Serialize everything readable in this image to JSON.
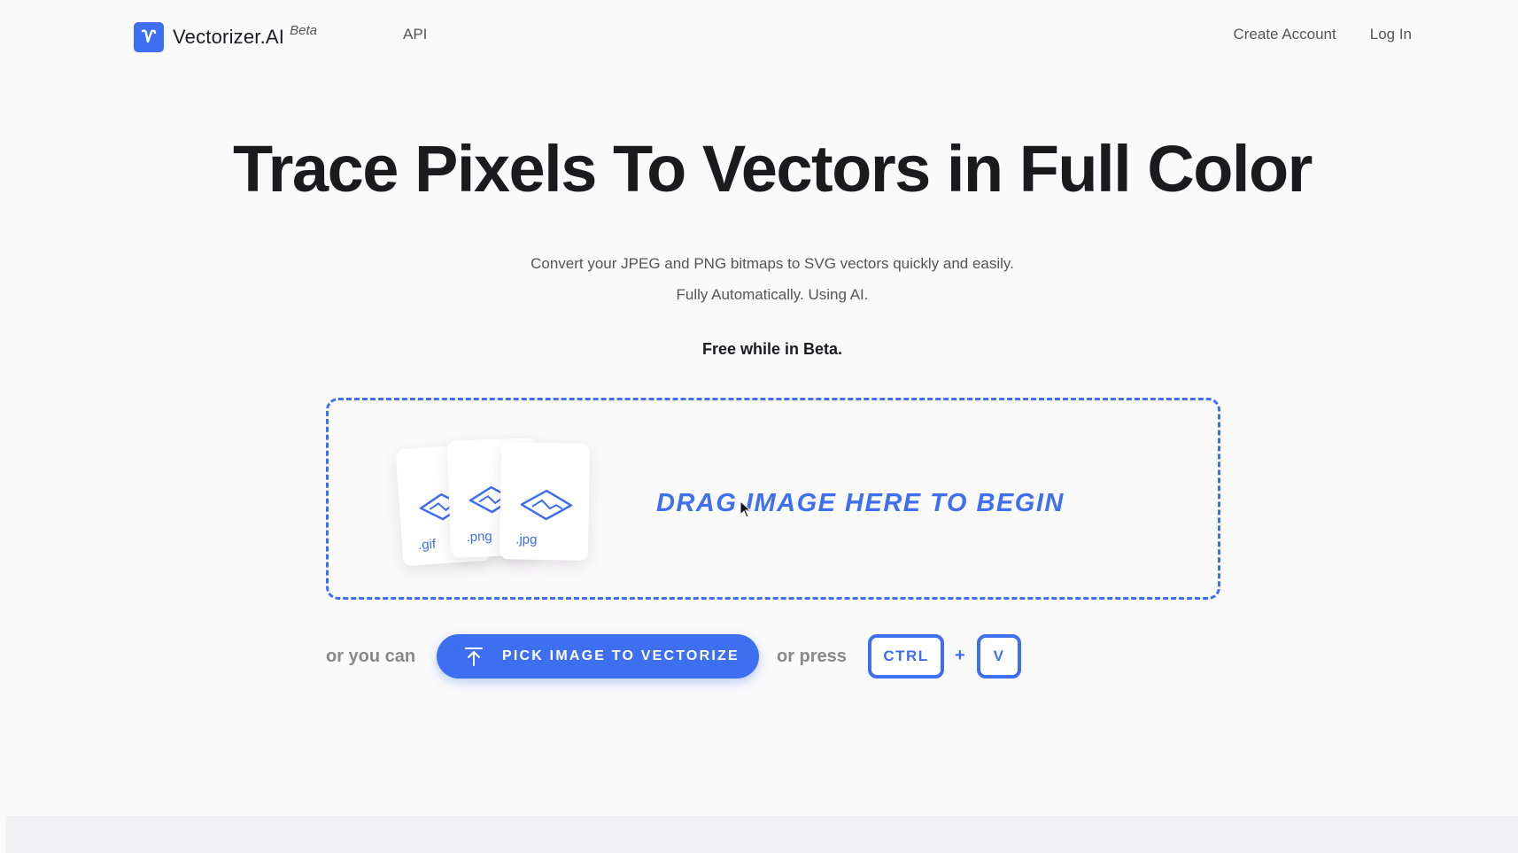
{
  "header": {
    "brand_name": "Vectorizer.AI",
    "brand_badge": "Beta",
    "nav_api": "API",
    "create_account": "Create Account",
    "log_in": "Log In"
  },
  "hero": {
    "title": "Trace Pixels To Vectors in Full Color",
    "subtitle_line1": "Convert your JPEG and PNG bitmaps to SVG vectors quickly and easily.",
    "subtitle_line2": "Fully Automatically. Using AI.",
    "free_note": "Free while in Beta."
  },
  "dropzone": {
    "prompt": "DRAG IMAGE HERE TO BEGIN",
    "file_types": [
      ".gif",
      ".png",
      ".jpg"
    ]
  },
  "actions": {
    "or_you_can": "or you can",
    "pick_button": "PICK IMAGE TO VECTORIZE",
    "or_press": "or press",
    "key_ctrl": "CTRL",
    "key_plus": "+",
    "key_v": "V"
  },
  "colors": {
    "accent": "#3e6ff0",
    "background": "#fbfafb",
    "text_primary": "#1b1b1d",
    "text_secondary": "#555555"
  },
  "icons": {
    "logo": "vectorizer-logo-icon",
    "upload": "upload-arrow-icon",
    "file_image": "image-file-icon",
    "cursor": "mouse-pointer-icon"
  }
}
